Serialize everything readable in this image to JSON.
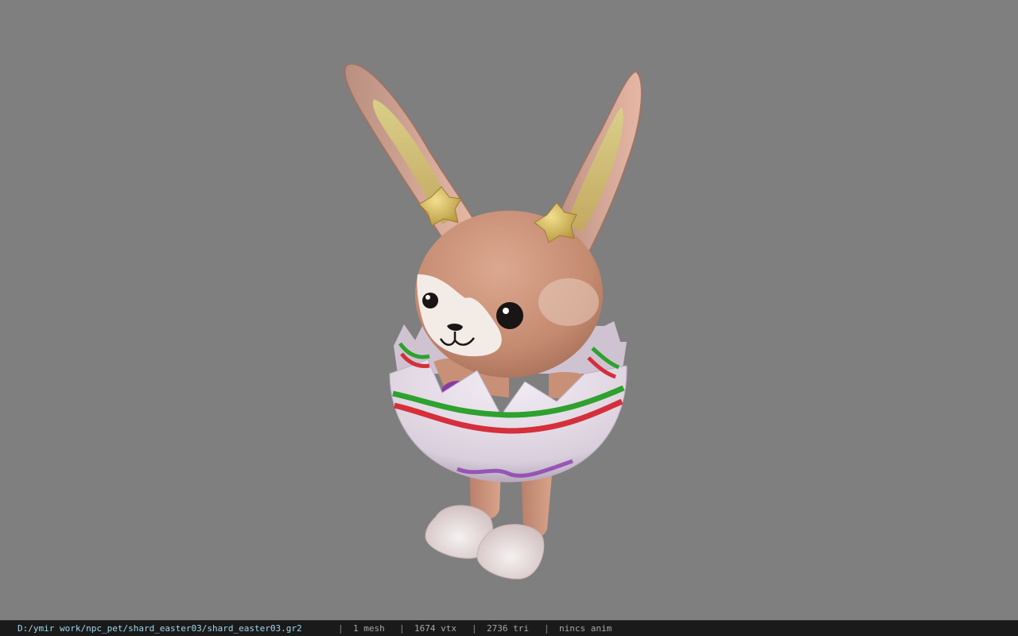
{
  "viewer": {
    "model_path": "D:/ymir work/npc_pet/shard_easter03/shard_easter03.gr2",
    "background_color": "#7f7f7f",
    "model_subject": "bunny-in-easter-egg"
  },
  "status": {
    "separator": "|",
    "mesh": "1 mesh",
    "vertices": "1674 vtx",
    "triangles": "2736 tri",
    "anim": "nincs anim"
  }
}
